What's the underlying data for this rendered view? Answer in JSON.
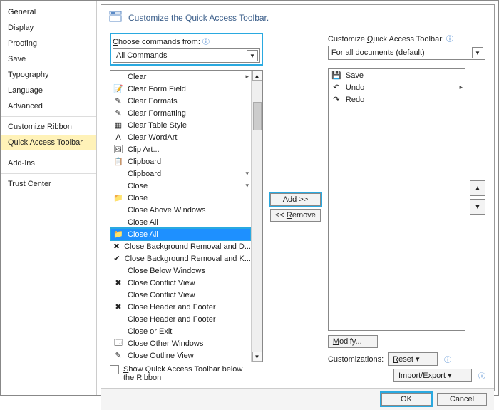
{
  "sidebar": {
    "items": [
      "General",
      "Display",
      "Proofing",
      "Save",
      "Typography",
      "Language",
      "Advanced",
      "Customize Ribbon",
      "Quick Access Toolbar",
      "Add-Ins",
      "Trust Center"
    ],
    "active_index": 8
  },
  "header": "Customize the Quick Access Toolbar.",
  "left": {
    "label_pre": "C",
    "label_post": "hoose commands from:",
    "select": "All Commands",
    "items": [
      {
        "icon": "",
        "label": "Clear",
        "expand": true
      },
      {
        "icon": "📝",
        "label": "Clear Form Field"
      },
      {
        "icon": "✎",
        "label": "Clear Formats"
      },
      {
        "icon": "✎",
        "label": "Clear Formatting"
      },
      {
        "icon": "▦",
        "label": "Clear Table Style"
      },
      {
        "icon": "A",
        "label": "Clear WordArt"
      },
      {
        "icon": "🖼",
        "label": "Clip Art..."
      },
      {
        "icon": "📋",
        "label": "Clipboard"
      },
      {
        "icon": "",
        "label": "Clipboard",
        "drop": true
      },
      {
        "icon": "",
        "label": "Close",
        "drop": true
      },
      {
        "icon": "📁",
        "label": "Close"
      },
      {
        "icon": "",
        "label": "Close Above Windows"
      },
      {
        "icon": "",
        "label": "Close All"
      },
      {
        "icon": "📁",
        "label": "Close All",
        "selected": true,
        "hl": true
      },
      {
        "icon": "✖",
        "label": "Close Background Removal and D..."
      },
      {
        "icon": "✔",
        "label": "Close Background Removal and K..."
      },
      {
        "icon": "",
        "label": "Close Below Windows"
      },
      {
        "icon": "✖",
        "label": "Close Conflict View"
      },
      {
        "icon": "",
        "label": "Close Conflict View"
      },
      {
        "icon": "✖",
        "label": "Close Header and Footer"
      },
      {
        "icon": "",
        "label": "Close Header and Footer"
      },
      {
        "icon": "",
        "label": "Close or Exit"
      },
      {
        "icon": "🗔",
        "label": "Close Other Windows"
      },
      {
        "icon": "✎",
        "label": "Close Outline View"
      }
    ]
  },
  "right": {
    "label_pre": "Customize ",
    "label_u": "Q",
    "label_post": "uick Access Toolbar:",
    "select": "For all documents (default)",
    "items": [
      {
        "icon": "💾",
        "label": "Save"
      },
      {
        "icon": "↶",
        "label": "Undo",
        "expand": true
      },
      {
        "icon": "↷",
        "label": "Redo"
      }
    ]
  },
  "buttons": {
    "add": "Add >>",
    "remove": "<< Remove",
    "modify": "Modify...",
    "reset": "Reset ▾",
    "import_export": "Import/Export ▾",
    "ok": "OK",
    "cancel": "Cancel"
  },
  "checkbox_pre": "S",
  "checkbox_post": "how Quick Access Toolbar below the Ribbon",
  "customizations_label": "Customizations:",
  "modify_u": "M",
  "remove_u": "R",
  "add_u": "A",
  "reset_part": "eset ▾",
  "reset_u": "R"
}
